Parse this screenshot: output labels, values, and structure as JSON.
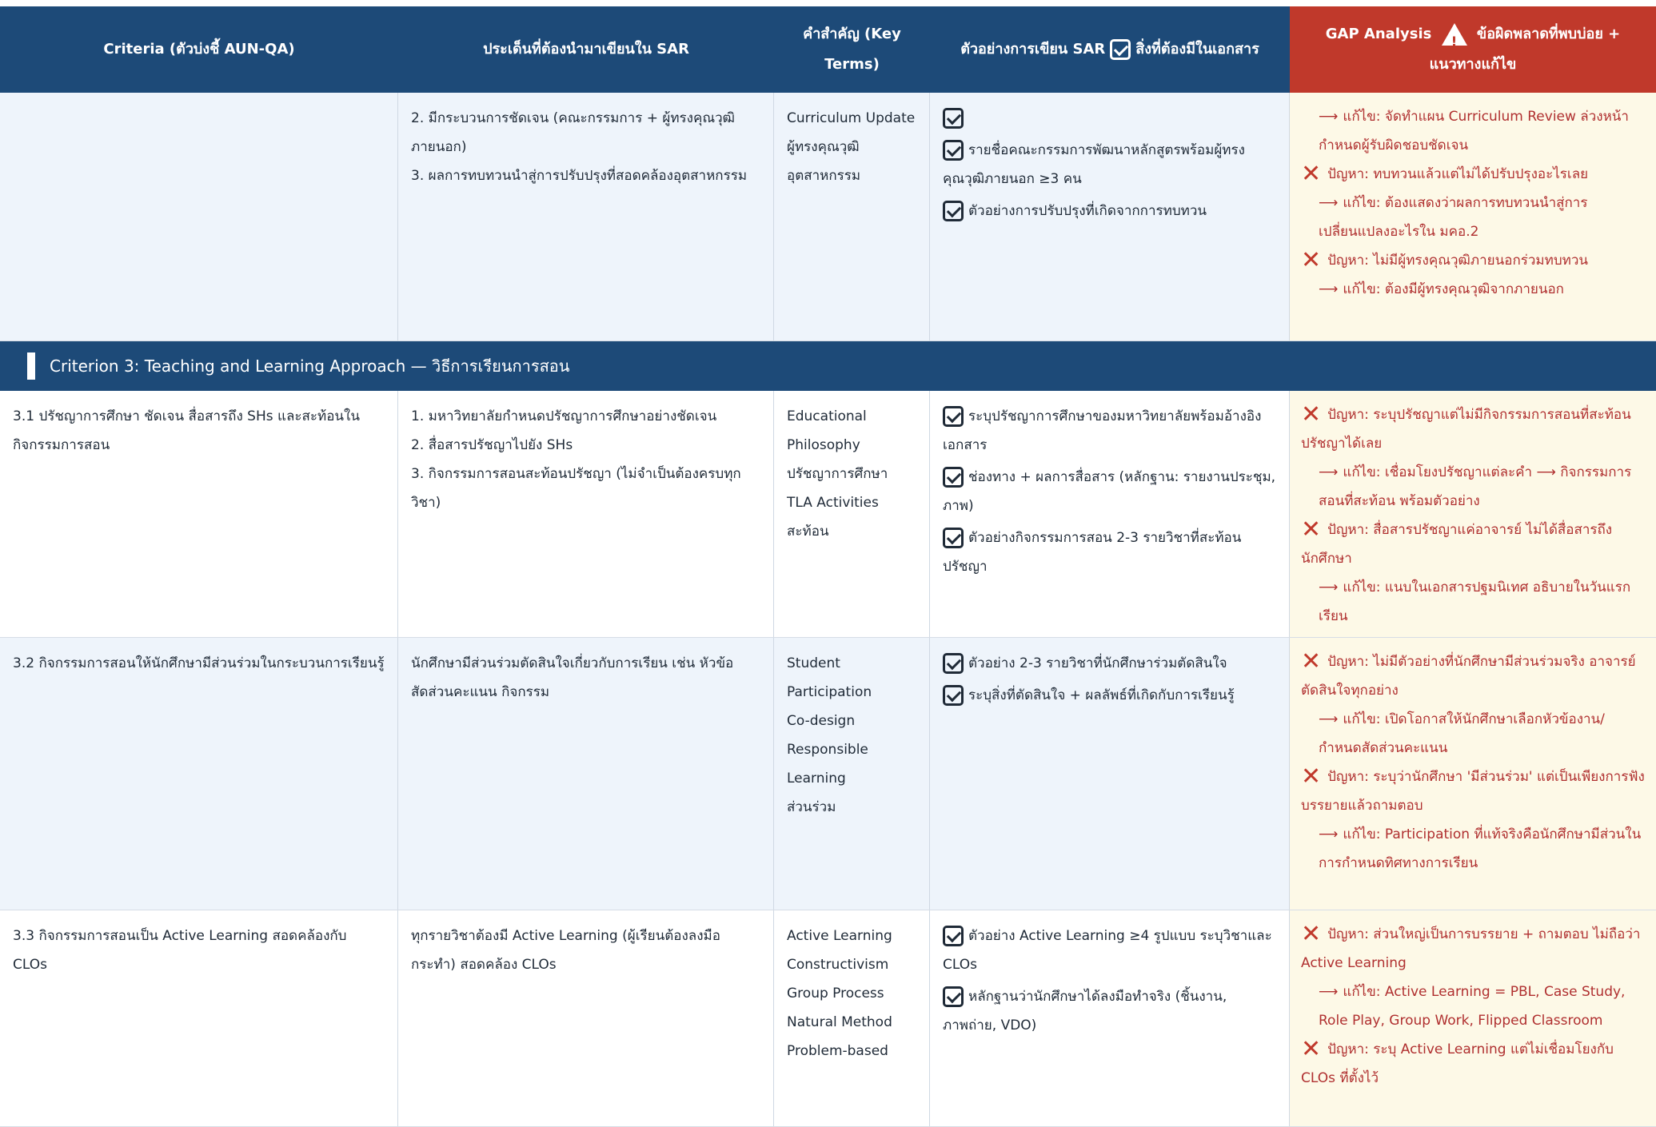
{
  "header": {
    "col1": "Criteria (ตัวบ่งชี้ AUN-QA)",
    "col2": "ประเด็นที่ต้องนำมาเขียนใน SAR",
    "col3": "คำสำคัญ (Key Terms)",
    "col4_a": "ตัวอย่างการเขียน SAR",
    "col4_b": "สิ่งที่ต้องมีในเอกสาร",
    "col5_a": "GAP Analysis",
    "col5_b": "ข้อผิดพลาดที่พบบ่อย + แนวทางแก้ไข"
  },
  "rows_top": {
    "criteria": "",
    "points": [
      "2. มีกระบวนการชัดเจน (คณะกรรมการ + ผู้ทรงคุณวุฒิภายนอก)",
      "3. ผลการทบทวนนำสู่การปรับปรุงที่สอดคล้องอุตสาหกรรม"
    ],
    "terms": [
      "Curriculum Update",
      "ผู้ทรงคุณวุฒิ",
      "อุตสาหกรรม"
    ],
    "sar": [
      "",
      "รายชื่อคณะกรรมการพัฒนาหลักสูตรพร้อมผู้ทรงคุณวุฒิภายนอก ≥3 คน",
      "ตัวอย่างการปรับปรุงที่เกิดจากการทบทวน"
    ],
    "gap": [
      {
        "kind": "fix",
        "text": "แก้ไข: จัดทำแผน Curriculum Review ล่วงหน้า กำหนดผู้รับผิดชอบชัดเจน"
      },
      {
        "kind": "prob",
        "text": "ปัญหา: ทบทวนแล้วแต่ไม่ได้ปรับปรุงอะไรเลย"
      },
      {
        "kind": "fix",
        "text": "แก้ไข: ต้องแสดงว่าผลการทบทวนนำสู่การเปลี่ยนแปลงอะไรใน มคอ.2"
      },
      {
        "kind": "prob",
        "text": "ปัญหา: ไม่มีผู้ทรงคุณวุฒิภายนอกร่วมทบทวน"
      },
      {
        "kind": "fix",
        "text": "แก้ไข: ต้องมีผู้ทรงคุณวุฒิจากภายนอก"
      }
    ]
  },
  "section3": {
    "title": "Criterion 3: Teaching and Learning Approach — วิธีการเรียนการสอน"
  },
  "r31": {
    "criteria": "3.1 ปรัชญาการศึกษา ชัดเจน สื่อสารถึง SHs และสะท้อนในกิจกรรมการสอน",
    "points": [
      "1. มหาวิทยาลัยกำหนดปรัชญาการศึกษาอย่างชัดเจน",
      "2. สื่อสารปรัชญาไปยัง SHs",
      "3. กิจกรรมการสอนสะท้อนปรัชญา (ไม่จำเป็นต้องครบทุกวิชา)"
    ],
    "terms": [
      "Educational Philosophy",
      "ปรัชญาการศึกษา",
      "TLA Activities",
      "สะท้อน"
    ],
    "sar": [
      "ระบุปรัชญาการศึกษาของมหาวิทยาลัยพร้อมอ้างอิงเอกสาร",
      "ช่องทาง + ผลการสื่อสาร (หลักฐาน: รายงานประชุม, ภาพ)",
      "ตัวอย่างกิจกรรมการสอน 2-3 รายวิชาที่สะท้อนปรัชญา"
    ],
    "gap": [
      {
        "kind": "prob",
        "text": "ปัญหา: ระบุปรัชญาแต่ไม่มีกิจกรรมการสอนที่สะท้อนปรัชญาได้เลย"
      },
      {
        "kind": "fix",
        "text": "แก้ไข: เชื่อมโยงปรัชญาแต่ละคำ ⟶ กิจกรรมการสอนที่สะท้อน พร้อมตัวอย่าง"
      },
      {
        "kind": "prob",
        "text": "ปัญหา: สื่อสารปรัชญาแค่อาจารย์ ไม่ได้สื่อสารถึงนักศึกษา"
      },
      {
        "kind": "fix",
        "text": "แก้ไข: แนบในเอกสารปฐมนิเทศ อธิบายในวันแรกเรียน"
      }
    ]
  },
  "r32": {
    "criteria": "3.2 กิจกรรมการสอนให้นักศึกษามีส่วนร่วมในกระบวนการเรียนรู้",
    "points": [
      "นักศึกษามีส่วนร่วมตัดสินใจเกี่ยวกับการเรียน เช่น หัวข้อ สัดส่วนคะแนน กิจกรรม"
    ],
    "terms": [
      "Student Participation",
      "Co-design",
      "Responsible Learning",
      "ส่วนร่วม"
    ],
    "sar": [
      "ตัวอย่าง 2-3 รายวิชาที่นักศึกษาร่วมตัดสินใจ",
      "ระบุสิ่งที่ตัดสินใจ + ผลลัพธ์ที่เกิดกับการเรียนรู้"
    ],
    "gap": [
      {
        "kind": "prob",
        "text": "ปัญหา: ไม่มีตัวอย่างที่นักศึกษามีส่วนร่วมจริง อาจารย์ตัดสินใจทุกอย่าง"
      },
      {
        "kind": "fix",
        "text": "แก้ไข: เปิดโอกาสให้นักศึกษาเลือกหัวข้องาน/กำหนดสัดส่วนคะแนน"
      },
      {
        "kind": "prob",
        "text": "ปัญหา: ระบุว่านักศึกษา 'มีส่วนร่วม' แต่เป็นเพียงการฟังบรรยายแล้วถามตอบ"
      },
      {
        "kind": "fix",
        "text": "แก้ไข: Participation ที่แท้จริงคือนักศึกษามีส่วนในการกำหนดทิศทางการเรียน"
      }
    ]
  },
  "r33": {
    "criteria": "3.3 กิจกรรมการสอนเป็น Active Learning สอดคล้องกับ CLOs",
    "points": [
      "ทุกรายวิชาต้องมี Active Learning (ผู้เรียนต้องลงมือกระทำ) สอดคล้อง CLOs"
    ],
    "terms": [
      "Active Learning",
      "Constructivism",
      "Group Process",
      "Natural Method",
      "Problem-based"
    ],
    "sar": [
      "ตัวอย่าง Active Learning ≥4 รูปแบบ ระบุวิชาและ CLOs",
      "หลักฐานว่านักศึกษาได้ลงมือทำจริง (ชิ้นงาน, ภาพถ่าย, VDO)"
    ],
    "gap": [
      {
        "kind": "prob",
        "text": "ปัญหา: ส่วนใหญ่เป็นการบรรยาย + ถามตอบ ไม่ถือว่า Active Learning"
      },
      {
        "kind": "fix",
        "text": "แก้ไข: Active Learning = PBL, Case Study, Role Play, Group Work, Flipped Classroom"
      },
      {
        "kind": "prob",
        "text": "ปัญหา: ระบุ Active Learning แต่ไม่เชื่อมโยงกับ CLOs ที่ตั้งไว้"
      }
    ]
  },
  "colors": {
    "header": "#1d4a78",
    "gap_header": "#c0392b",
    "gap_bg": "#fdf9e7",
    "shade": "#eef4fb",
    "problem": "#b03030"
  }
}
